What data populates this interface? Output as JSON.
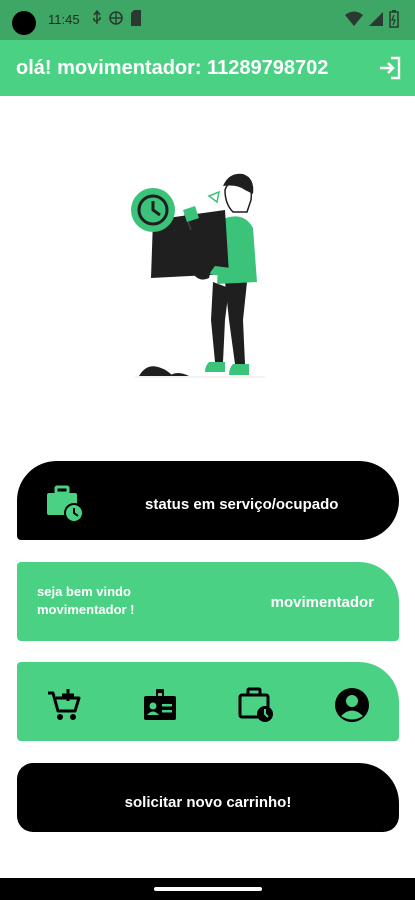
{
  "status_bar": {
    "time": "11:45"
  },
  "header": {
    "title": "olá! movimentador: 11289798702",
    "logout_icon": "logout-icon"
  },
  "status_card": {
    "label": "status em serviço/ocupado",
    "icon": "briefcase-clock-icon"
  },
  "welcome_card": {
    "greeting": "seja bem vindo movimentador !",
    "role": "movimentador"
  },
  "menu": {
    "items": [
      {
        "icon": "cart-add-icon"
      },
      {
        "icon": "id-badge-icon"
      },
      {
        "icon": "briefcase-clock-icon"
      },
      {
        "icon": "account-circle-icon"
      }
    ]
  },
  "request_button": {
    "label": "solicitar novo carrinho!"
  },
  "colors": {
    "status_bar": "#3fa765",
    "primary_green": "#4bd184",
    "dark": "#000000",
    "text_on_dark": "#ffffff"
  }
}
